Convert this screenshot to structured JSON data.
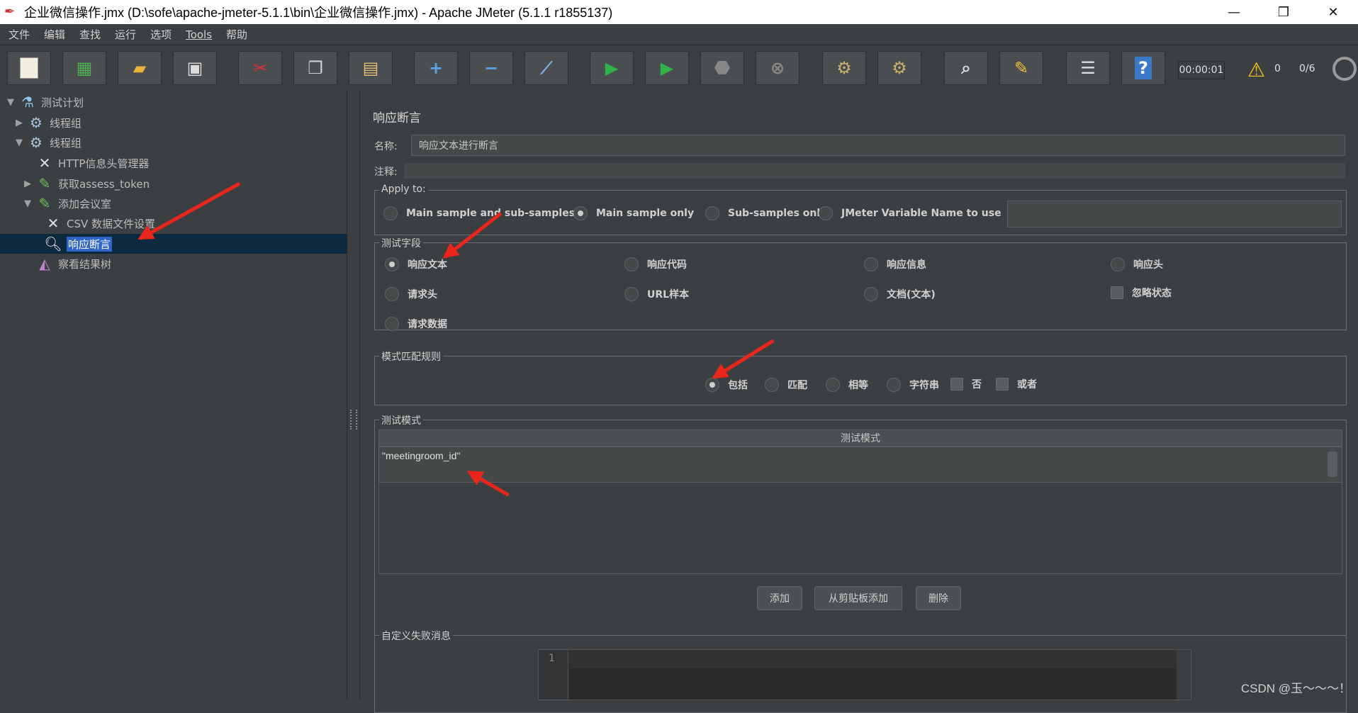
{
  "window": {
    "title": "企业微信操作.jmx (D:\\sofe\\apache-jmeter-5.1.1\\bin\\企业微信操作.jmx) - Apache JMeter (5.1.1 r1855137)",
    "minimize": "—",
    "maximize": "❐",
    "close": "✕"
  },
  "menu": [
    "文件",
    "编辑",
    "查找",
    "运行",
    "选项",
    "Tools",
    "帮助"
  ],
  "toolbar": {
    "icons": [
      "new-icon",
      "templates-icon",
      "open-icon",
      "save-icon",
      "cut-icon",
      "copy-icon",
      "paste-icon",
      "expand-icon",
      "collapse-icon",
      "toggle-icon",
      "start-icon",
      "start-no-pauses-icon",
      "stop-icon",
      "shutdown-icon",
      "clear-icon",
      "clear-all-icon",
      "search-icon",
      "reset-search-icon",
      "function-helper-icon",
      "help-icon"
    ],
    "timer": "00:00:01",
    "warnings": "0",
    "threads": "0/6"
  },
  "tree": {
    "items": [
      {
        "label": "测试计划",
        "icon": "test-plan-icon"
      },
      {
        "label": "线程组",
        "icon": "thread-group-icon"
      },
      {
        "label": "线程组",
        "icon": "thread-group-icon"
      },
      {
        "label": "HTTP信息头管理器",
        "icon": "header-manager-icon"
      },
      {
        "label": "获取assess_token",
        "icon": "http-sampler-icon"
      },
      {
        "label": "添加会议室",
        "icon": "http-sampler-icon"
      },
      {
        "label": "CSV 数据文件设置",
        "icon": "csv-config-icon"
      },
      {
        "label": "响应断言",
        "icon": "assertion-icon"
      },
      {
        "label": "察看结果树",
        "icon": "results-tree-icon"
      }
    ]
  },
  "panel": {
    "title": "响应断言",
    "name_label": "名称:",
    "name_value": "响应文本进行断言",
    "comment_label": "注释:",
    "comment_value": "",
    "apply_to": {
      "title": "Apply to:",
      "options": [
        "Main sample and sub-samples",
        "Main sample only",
        "Sub-samples only",
        "JMeter Variable Name to use"
      ],
      "selected": "Main sample only",
      "variable_value": ""
    },
    "field_to_test": {
      "title": "测试字段",
      "options": [
        "响应文本",
        "响应代码",
        "响应信息",
        "响应头",
        "请求头",
        "URL样本",
        "文档(文本)",
        "请求数据"
      ],
      "ignore_status": "忽略状态",
      "selected": "响应文本"
    },
    "pattern_rules": {
      "title": "模式匹配规则",
      "radios": [
        "包括",
        "匹配",
        "相等",
        "字符串"
      ],
      "checks": [
        "否",
        "或者"
      ],
      "selected": "包括"
    },
    "patterns": {
      "title": "测试模式",
      "column": "测试模式",
      "rows": [
        "\"meetingroom_id\""
      ]
    },
    "buttons": {
      "add": "添加",
      "add_clipboard": "从剪贴板添加",
      "delete": "删除"
    },
    "failure_message": {
      "title": "自定义失败消息",
      "line_number": "1",
      "value": ""
    }
  },
  "watermark": "CSDN @玉～～～！",
  "colors": {
    "annotation_arrow": "#e8261c",
    "selection": "#2f65ca"
  }
}
